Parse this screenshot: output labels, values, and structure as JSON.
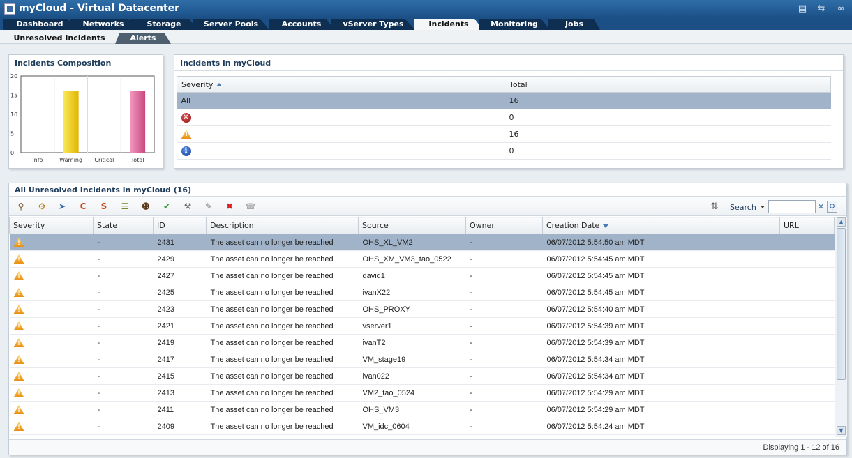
{
  "window": {
    "title": "myCloud - Virtual Datacenter"
  },
  "tabs": [
    {
      "label": "Dashboard"
    },
    {
      "label": "Networks"
    },
    {
      "label": "Storage"
    },
    {
      "label": "Server Pools"
    },
    {
      "label": "Accounts"
    },
    {
      "label": "vServer Types"
    },
    {
      "label": "Incidents"
    },
    {
      "label": "Monitoring"
    },
    {
      "label": "Jobs"
    }
  ],
  "active_tab": "Incidents",
  "subtabs": [
    {
      "label": "Unresolved Incidents"
    },
    {
      "label": "Alerts"
    }
  ],
  "composition": {
    "title": "Incidents Composition",
    "chart_data": {
      "type": "bar",
      "categories": [
        "Info",
        "Warning",
        "Critical",
        "Total"
      ],
      "values": [
        0,
        16,
        0,
        16
      ],
      "yticks": [
        "0",
        "5",
        "10",
        "15",
        "20"
      ],
      "ylim": [
        0,
        20
      ],
      "grid": true,
      "colors": {
        "Warning": "#f2d624",
        "Total": "#e07aa6"
      }
    }
  },
  "summary": {
    "title": "Incidents in myCloud",
    "columns": [
      "Severity",
      "Total"
    ],
    "rows": [
      {
        "severity": "All",
        "icon": "",
        "total": "16"
      },
      {
        "severity": "",
        "icon": "critical-icon",
        "total": "0"
      },
      {
        "severity": "",
        "icon": "warning-icon",
        "total": "16"
      },
      {
        "severity": "",
        "icon": "info-icon",
        "total": "0"
      }
    ]
  },
  "incidents": {
    "title": "All Unresolved Incidents in myCloud (16)",
    "search_label": "Search",
    "search_value": "",
    "columns": [
      "Severity",
      "State",
      "ID",
      "Description",
      "Source",
      "Owner",
      "Creation Date",
      "URL"
    ],
    "rows": [
      {
        "state": "-",
        "id": "2431",
        "description": "The asset can no longer be reached",
        "source": "OHS_XL_VM2",
        "owner": "-",
        "created": "06/07/2012 5:54:50 am MDT",
        "url": ""
      },
      {
        "state": "-",
        "id": "2429",
        "description": "The asset can no longer be reached",
        "source": "OHS_XM_VM3_tao_0522",
        "owner": "-",
        "created": "06/07/2012 5:54:45 am MDT",
        "url": ""
      },
      {
        "state": "-",
        "id": "2427",
        "description": "The asset can no longer be reached",
        "source": "david1",
        "owner": "-",
        "created": "06/07/2012 5:54:45 am MDT",
        "url": ""
      },
      {
        "state": "-",
        "id": "2425",
        "description": "The asset can no longer be reached",
        "source": "ivanX22",
        "owner": "-",
        "created": "06/07/2012 5:54:45 am MDT",
        "url": ""
      },
      {
        "state": "-",
        "id": "2423",
        "description": "The asset can no longer be reached",
        "source": "OHS_PROXY",
        "owner": "-",
        "created": "06/07/2012 5:54:40 am MDT",
        "url": ""
      },
      {
        "state": "-",
        "id": "2421",
        "description": "The asset can no longer be reached",
        "source": "vserver1",
        "owner": "-",
        "created": "06/07/2012 5:54:39 am MDT",
        "url": ""
      },
      {
        "state": "-",
        "id": "2419",
        "description": "The asset can no longer be reached",
        "source": "ivanT2",
        "owner": "-",
        "created": "06/07/2012 5:54:39 am MDT",
        "url": ""
      },
      {
        "state": "-",
        "id": "2417",
        "description": "The asset can no longer be reached",
        "source": "VM_stage19",
        "owner": "-",
        "created": "06/07/2012 5:54:34 am MDT",
        "url": ""
      },
      {
        "state": "-",
        "id": "2415",
        "description": "The asset can no longer be reached",
        "source": "ivan022",
        "owner": "-",
        "created": "06/07/2012 5:54:34 am MDT",
        "url": ""
      },
      {
        "state": "-",
        "id": "2413",
        "description": "The asset can no longer be reached",
        "source": "VM2_tao_0524",
        "owner": "-",
        "created": "06/07/2012 5:54:29 am MDT",
        "url": ""
      },
      {
        "state": "-",
        "id": "2411",
        "description": "The asset can no longer be reached",
        "source": "OHS_VM3",
        "owner": "-",
        "created": "06/07/2012 5:54:29 am MDT",
        "url": ""
      },
      {
        "state": "-",
        "id": "2409",
        "description": "The asset can no longer be reached",
        "source": "VM_idc_0604",
        "owner": "-",
        "created": "06/07/2012 5:54:24 am MDT",
        "url": ""
      }
    ],
    "footer": "Displaying 1 - 12 of 16"
  },
  "toolbar_icons": [
    "view-details-icon",
    "assign-icon",
    "annotate-icon",
    "suppress-icon",
    "set-status-icon",
    "notes-icon",
    "owner-icon",
    "acknowledge-icon",
    "wrench-icon",
    "edit-icon",
    "delete-icon",
    "phone-icon"
  ],
  "colors": {
    "selected_row": "#a1b3c8",
    "header_blue": "#1b4f86",
    "tab_dark": "#0f2f52"
  }
}
